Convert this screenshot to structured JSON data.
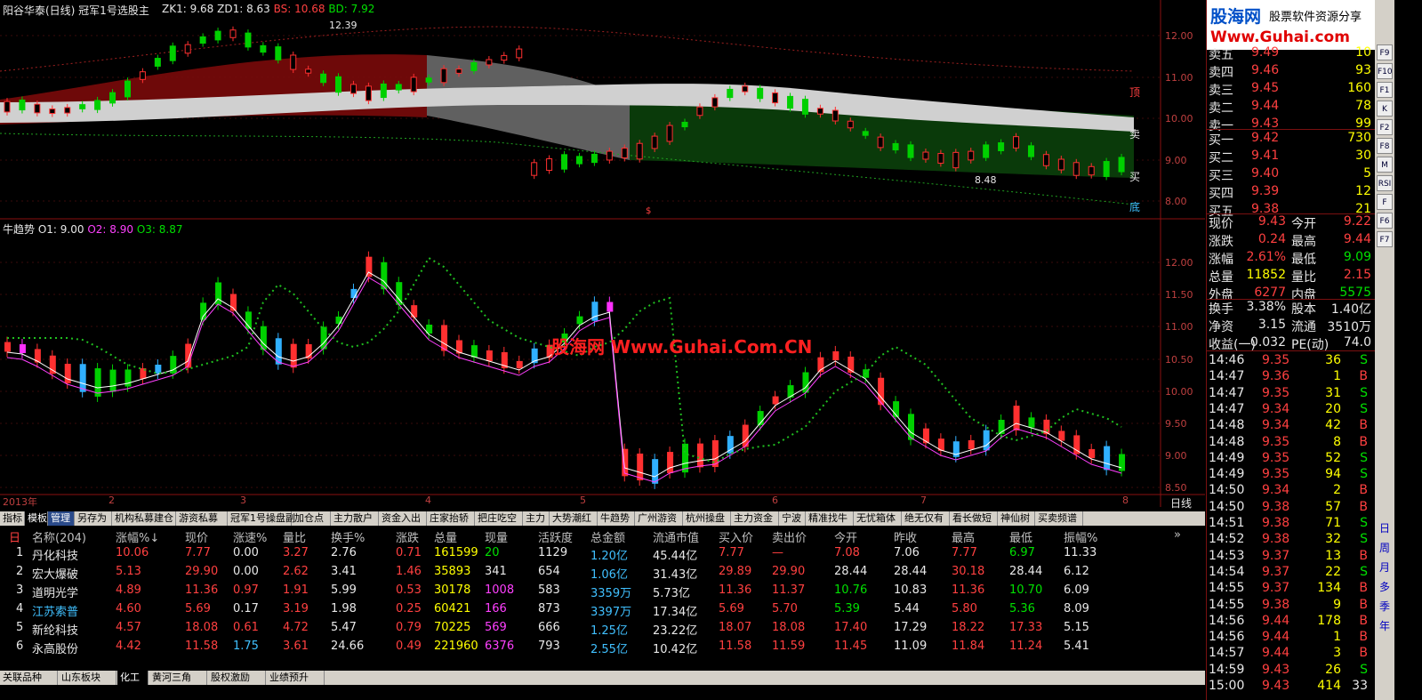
{
  "window": {
    "title": "阳谷华泰(日线) 冠军1号选股主",
    "zk": "ZK1: 9.68",
    "zd": "ZD1: 8.63",
    "bs": "BS: 10.68",
    "bd": "BD: 7.92",
    "top_high_label": "12.39",
    "top_low_label": "8.48",
    "marker_top": "顶",
    "marker_sell": "卖",
    "marker_buy": "买",
    "marker_bottom": "底",
    "marker_s": "$",
    "lower_title": "牛趋势",
    "o1": "O1: 9.00",
    "o2": "O2: 8.90",
    "o3": "O3: 8.87",
    "watermark": "股海网 Www.Guhai.Com.CN",
    "period": "日线",
    "upper_axis": [
      "12.00",
      "11.00",
      "10.00",
      "9.00",
      "8.00"
    ],
    "lower_axis": [
      "12.00",
      "11.50",
      "11.00",
      "10.50",
      "10.00",
      "9.50",
      "9.00",
      "8.50"
    ],
    "x_labels": [
      "2013年",
      "2",
      "3",
      "4",
      "5",
      "6",
      "7",
      "8"
    ]
  },
  "colors": {
    "up": "#ff3030",
    "down": "#00d000",
    "cyan": "#30b0ff",
    "magenta": "#ff30ff",
    "band": "#d0d0d0"
  },
  "quote": {
    "logo_a": "股海网",
    "logo_b": "股票软件资源分享",
    "logo_c": "Www.Guhai.com",
    "asks": [
      {
        "name": "卖五",
        "price": "9.49",
        "vol": "10"
      },
      {
        "name": "卖四",
        "price": "9.46",
        "vol": "93"
      },
      {
        "name": "卖三",
        "price": "9.45",
        "vol": "160"
      },
      {
        "name": "卖二",
        "price": "9.44",
        "vol": "78"
      },
      {
        "name": "卖一",
        "price": "9.43",
        "vol": "99"
      }
    ],
    "bids": [
      {
        "name": "买一",
        "price": "9.42",
        "vol": "730"
      },
      {
        "name": "买二",
        "price": "9.41",
        "vol": "30"
      },
      {
        "name": "买三",
        "price": "9.40",
        "vol": "5"
      },
      {
        "name": "买四",
        "price": "9.39",
        "vol": "12"
      },
      {
        "name": "买五",
        "price": "9.38",
        "vol": "21"
      }
    ],
    "stats": [
      {
        "l1": "现价",
        "v1": "9.43",
        "l2": "今开",
        "v2": "9.22"
      },
      {
        "l1": "涨跌",
        "v1": "0.24",
        "l2": "最高",
        "v2": "9.44"
      },
      {
        "l1": "涨幅",
        "v1": "2.61%",
        "l2": "最低",
        "v2": "9.09"
      },
      {
        "l1": "总量",
        "v1": "11852",
        "l2": "量比",
        "v2": "2.15"
      },
      {
        "l1": "外盘",
        "v1": "6277",
        "l2": "内盘",
        "v2": "5575"
      }
    ],
    "stats2": [
      {
        "l1": "换手",
        "v1": "3.38%",
        "l2": "股本",
        "v2": "1.40亿"
      },
      {
        "l1": "净资",
        "v1": "3.15",
        "l2": "流通",
        "v2": "3510万"
      },
      {
        "l1": "收益(一)",
        "v1": "0.032",
        "l2": "PE(动)",
        "v2": "74.0"
      }
    ],
    "ticks": [
      {
        "t": "14:46",
        "p": "9.35",
        "v": "36",
        "s": "S"
      },
      {
        "t": "14:47",
        "p": "9.36",
        "v": "1",
        "s": "B"
      },
      {
        "t": "14:47",
        "p": "9.35",
        "v": "31",
        "s": "S"
      },
      {
        "t": "14:47",
        "p": "9.34",
        "v": "20",
        "s": "S"
      },
      {
        "t": "14:48",
        "p": "9.34",
        "v": "42",
        "s": "B"
      },
      {
        "t": "14:48",
        "p": "9.35",
        "v": "8",
        "s": "B"
      },
      {
        "t": "14:49",
        "p": "9.35",
        "v": "52",
        "s": "S"
      },
      {
        "t": "14:49",
        "p": "9.35",
        "v": "94",
        "s": "S"
      },
      {
        "t": "14:50",
        "p": "9.34",
        "v": "2",
        "s": "B"
      },
      {
        "t": "14:50",
        "p": "9.38",
        "v": "57",
        "s": "B"
      },
      {
        "t": "14:51",
        "p": "9.38",
        "v": "71",
        "s": "S"
      },
      {
        "t": "14:52",
        "p": "9.38",
        "v": "32",
        "s": "S"
      },
      {
        "t": "14:53",
        "p": "9.37",
        "v": "13",
        "s": "B"
      },
      {
        "t": "14:54",
        "p": "9.37",
        "v": "22",
        "s": "S"
      },
      {
        "t": "14:55",
        "p": "9.37",
        "v": "134",
        "s": "B"
      },
      {
        "t": "14:55",
        "p": "9.38",
        "v": "9",
        "s": "B"
      },
      {
        "t": "14:56",
        "p": "9.44",
        "v": "178",
        "s": "B"
      },
      {
        "t": "14:56",
        "p": "9.44",
        "v": "1",
        "s": "B"
      },
      {
        "t": "14:57",
        "p": "9.44",
        "v": "3",
        "s": "B"
      },
      {
        "t": "14:59",
        "p": "9.43",
        "v": "26",
        "s": "S"
      },
      {
        "t": "15:00",
        "p": "9.43",
        "v": "414",
        "s": "33"
      }
    ]
  },
  "sidebar_icons": [
    "F9",
    "F10",
    "F1",
    "K",
    "F2",
    "F8",
    "M",
    "RSI",
    "F",
    "F6",
    "F7"
  ],
  "sidebar_vtext": [
    "日",
    "周",
    "月",
    "多",
    "季",
    "年"
  ],
  "tabs": [
    "指标",
    "模板",
    "管理",
    "另存为",
    "机构私募建仓",
    "游资私募",
    "冠军1号操盘副",
    "加仓点",
    "主力散户",
    "资金入出",
    "庄家抬轿",
    "把庄吃空",
    "主力",
    "大势潮红",
    "牛趋势",
    "广州游资",
    "杭州操盘",
    "主力资金",
    "宁波",
    "精准找牛",
    "无忧箱体",
    "绝无仅有",
    "看长做短",
    "神仙树",
    "买卖频谱"
  ],
  "table": {
    "headers": [
      "名称(204)",
      "涨幅%↓",
      "现价",
      "涨速%",
      "量比",
      "换手%",
      "涨跌",
      "总量",
      "现量",
      "活跃度",
      "总金额",
      "流通市值",
      "买入价",
      "卖出价",
      "今开",
      "昨收",
      "最高",
      "最低",
      "振幅%"
    ],
    "rows": [
      {
        "idx": "1",
        "name": "丹化科技",
        "chg": "10.06",
        "price": "7.77",
        "speed": "0.00",
        "lb": "3.27",
        "hs": "2.76",
        "zd": "0.71",
        "vol": "161599",
        "cur": "20",
        "act": "1129",
        "amt": "1.20亿",
        "mv": "45.44亿",
        "buy": "7.77",
        "sell": "—",
        "open": "7.08",
        "prev": "7.06",
        "high": "7.77",
        "low": "6.97",
        "amp": "11.33"
      },
      {
        "idx": "2",
        "name": "宏大爆破",
        "chg": "5.13",
        "price": "29.90",
        "speed": "0.00",
        "lb": "2.62",
        "hs": "3.41",
        "zd": "1.46",
        "vol": "35893",
        "cur": "341",
        "act": "654",
        "amt": "1.06亿",
        "mv": "31.43亿",
        "buy": "29.89",
        "sell": "29.90",
        "open": "28.44",
        "prev": "28.44",
        "high": "30.18",
        "low": "28.44",
        "amp": "6.12"
      },
      {
        "idx": "3",
        "name": "道明光学",
        "chg": "4.89",
        "price": "11.36",
        "speed": "0.97",
        "lb": "1.91",
        "hs": "5.99",
        "zd": "0.53",
        "vol": "30178",
        "cur": "1008",
        "act": "583",
        "amt": "3359万",
        "mv": "5.73亿",
        "buy": "11.36",
        "sell": "11.37",
        "open": "10.76",
        "prev": "10.83",
        "high": "11.36",
        "low": "10.70",
        "amp": "6.09"
      },
      {
        "idx": "4",
        "name": "江苏索普",
        "chg": "4.60",
        "price": "5.69",
        "speed": "0.17",
        "lb": "3.19",
        "hs": "1.98",
        "zd": "0.25",
        "vol": "60421",
        "cur": "166",
        "act": "873",
        "amt": "3397万",
        "mv": "17.34亿",
        "buy": "5.69",
        "sell": "5.70",
        "open": "5.39",
        "prev": "5.44",
        "high": "5.80",
        "low": "5.36",
        "amp": "8.09"
      },
      {
        "idx": "5",
        "name": "新纶科技",
        "chg": "4.57",
        "price": "18.08",
        "speed": "0.61",
        "lb": "4.72",
        "hs": "5.47",
        "zd": "0.79",
        "vol": "70225",
        "cur": "569",
        "act": "666",
        "amt": "1.25亿",
        "mv": "23.22亿",
        "buy": "18.07",
        "sell": "18.08",
        "open": "17.40",
        "prev": "17.29",
        "high": "18.22",
        "low": "17.33",
        "amp": "5.15"
      },
      {
        "idx": "6",
        "name": "永高股份",
        "chg": "4.42",
        "price": "11.58",
        "speed": "1.75",
        "lb": "3.61",
        "hs": "24.66",
        "zd": "0.49",
        "vol": "221960",
        "cur": "6376",
        "act": "793",
        "amt": "2.55亿",
        "mv": "10.42亿",
        "buy": "11.58",
        "sell": "11.59",
        "open": "11.45",
        "prev": "11.09",
        "high": "11.84",
        "low": "11.24",
        "amp": "5.41"
      }
    ]
  },
  "bottom_tabs": [
    "关联品种",
    "山东板块",
    "化工",
    "黄河三角",
    "股权激励",
    "业绩预升"
  ]
}
